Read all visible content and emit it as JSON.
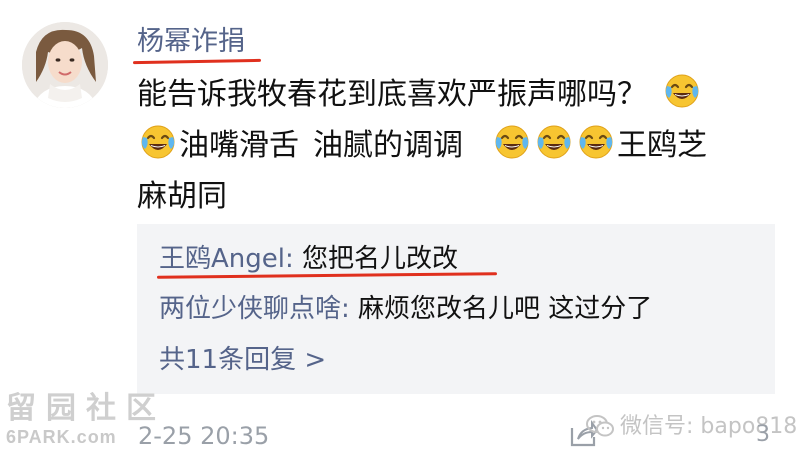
{
  "comment": {
    "username": "杨幂诈捐",
    "line1": "能告诉我牧春花到底喜欢严振声哪吗？",
    "line2_a": "油嘴滑舌",
    "line2_b": "油腻的调调",
    "line2_c": "王鸥芝",
    "line3": "麻胡同",
    "timestamp": "2-25 20:35",
    "like_count": "3"
  },
  "replies": [
    {
      "name": "王鸥Angel",
      "sep": ": ",
      "text": "您把名儿改改"
    },
    {
      "name": "两位少侠聊点啥",
      "sep": ": ",
      "text": "麻烦您改名儿吧 这过分了"
    }
  ],
  "more_replies": "共11条回复 >",
  "watermarks": {
    "site_cn": "留园社区",
    "site_en": "6PARK.com",
    "wechat": "微信号: bapo818"
  },
  "colors": {
    "link": "#55648a",
    "underline": "#e0301e",
    "reply_bg": "#f3f4f6",
    "meta": "#9aa0a8"
  },
  "icons": [
    "avatar",
    "laughing-crying-emoji",
    "share-icon",
    "wechat-icon"
  ]
}
